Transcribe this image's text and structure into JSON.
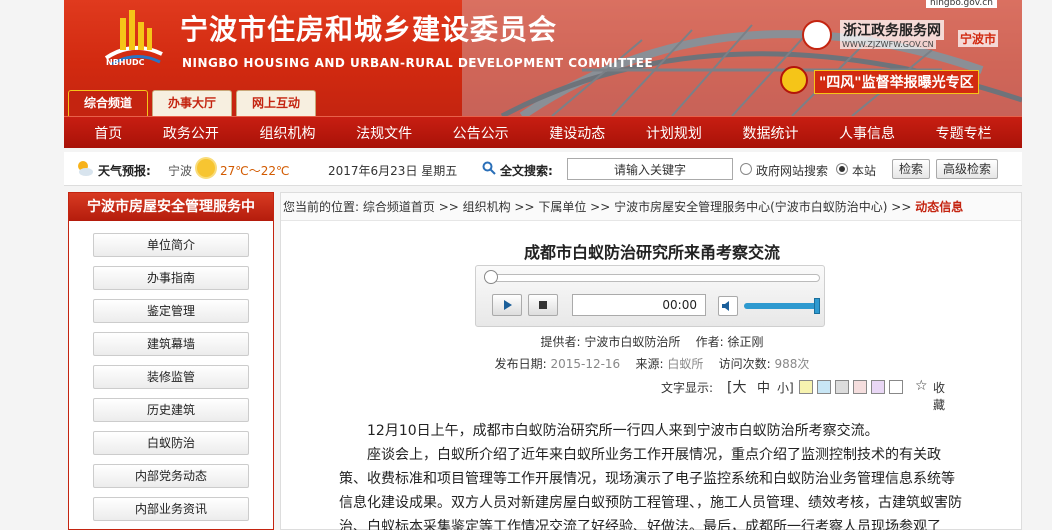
{
  "header": {
    "title": "宁波市住房和城乡建设委员会",
    "subtitle": "NINGBO HOUSING AND URBAN-RURAL DEVELOPMENT COMMITTEE",
    "logo_text": "NBHUDC",
    "top_url": "ningbo.gov.cn",
    "zjw_name": "浙江政务服务网",
    "zjw_url": "WWW.ZJZWFW.GOV.CN",
    "zjw_city": "宁波市",
    "sifeng": "\"四风\"监督举报曝光专区"
  },
  "tabs": [
    "综合频道",
    "办事大厅",
    "网上互动"
  ],
  "nav": [
    "首页",
    "政务公开",
    "组织机构",
    "法规文件",
    "公告公示",
    "建设动态",
    "计划规划",
    "数据统计",
    "人事信息",
    "专题专栏"
  ],
  "infobar": {
    "weather_label": "天气预报:",
    "weather_city": "宁波",
    "weather_temp": "27℃～22℃",
    "date": "2017年6月23日  星期五",
    "search_label": "全文搜索:",
    "search_placeholder": "请输入关键字",
    "radio_gov": "政府网站搜索",
    "radio_site": "本站",
    "btn_search": "检索",
    "btn_advanced": "高级检索"
  },
  "sidebar": {
    "title": "宁波市房屋安全管理服务中",
    "items": [
      "单位简介",
      "办事指南",
      "鉴定管理",
      "建筑幕墙",
      "装修监管",
      "历史建筑",
      "白蚁防治",
      "内部党务动态",
      "内部业务资讯"
    ]
  },
  "breadcrumb": {
    "prefix": "您当前的位置:",
    "path": "综合频道首页 >> 组织机构 >> 下属单位 >> 宁波市房屋安全管理服务中心(宁波市白蚁防治中心) >>",
    "current": "动态信息"
  },
  "article": {
    "title": "成都市白蚁防治研究所来甬考察交流",
    "player_time": "00:00",
    "provider_label": "提供者:",
    "provider": "宁波市白蚁防治所",
    "author_label": "作者:",
    "author": "徐正刚",
    "date_label": "发布日期:",
    "date": "2015-12-16",
    "source_label": "来源:",
    "source": "白蚁所",
    "visits_label": "访问次数:",
    "visits": "988次",
    "textsize_label": "文字显示:",
    "size_large": "大",
    "size_mid": "中",
    "size_small": "小",
    "swatches": [
      "#f7f3b0",
      "#c8e6f5",
      "#dcdcdc",
      "#f5dede",
      "#e9d7f5",
      "#ffffff"
    ],
    "favorite": "收藏",
    "paragraphs": [
      "12月10日上午，成都市白蚁防治研究所一行四人来到宁波市白蚁防治所考察交流。",
      "座谈会上，白蚁所介绍了近年来白蚁所业务工作开展情况，重点介绍了监测控制技术的有关政策、收费标准和项目管理等工作开展情况，现场演示了电子监控系统和白蚁防治业务管理信息系统等信息化建设成果。双方人员对新建房屋白蚁预防工程管理、，施工人员管理、绩效考核，古建筑蚁害防治、白蚁标本采集鉴定等工作情况交流了好经验、好做法。最后，成都所一行考察人员现场参观了"
    ]
  },
  "player": {
    "volume_fraction": 1.0
  }
}
